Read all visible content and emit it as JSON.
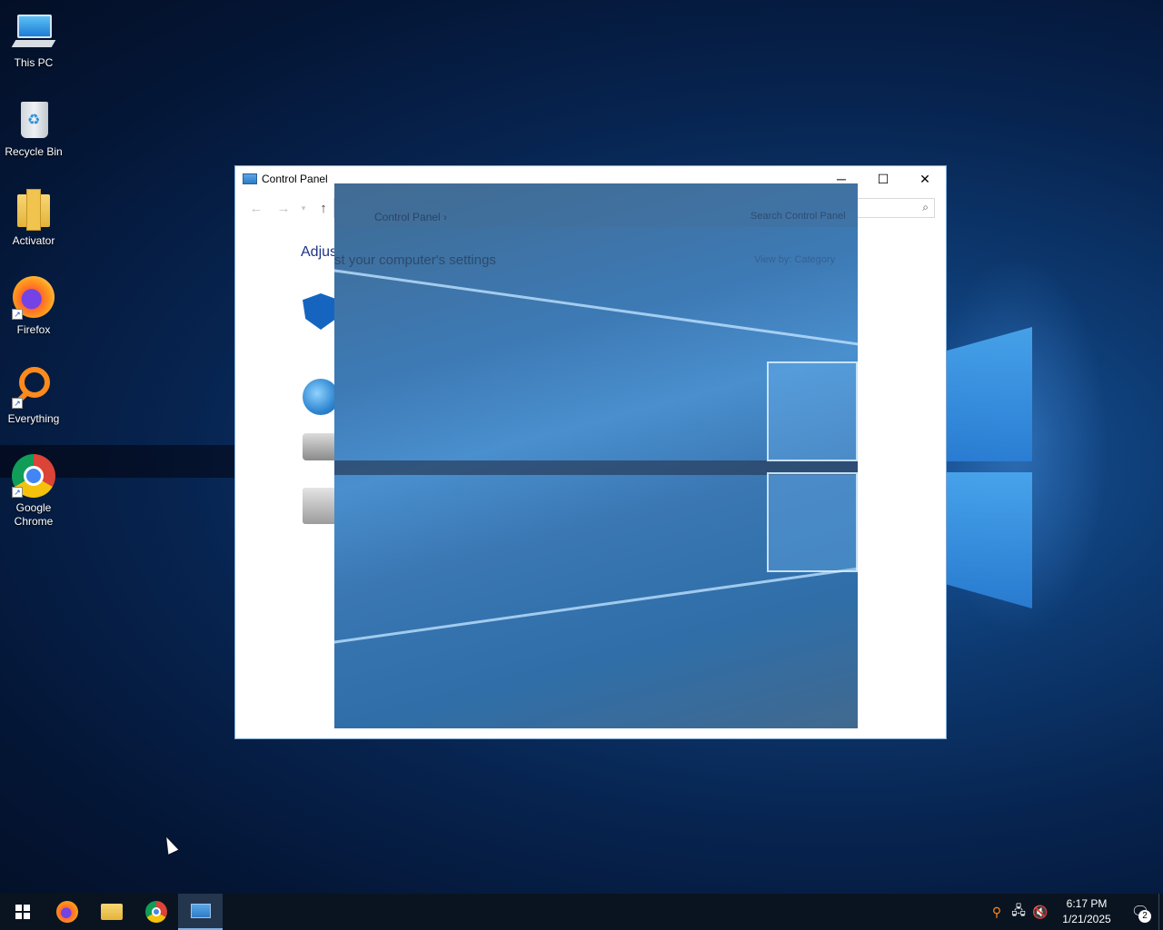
{
  "desktop": {
    "icons": [
      {
        "label": "This PC",
        "icon": "this-pc-icon"
      },
      {
        "label": "Recycle Bin",
        "icon": "recycle-bin-icon"
      },
      {
        "label": "Activator",
        "icon": "folder-icon"
      },
      {
        "label": "Firefox",
        "icon": "firefox-icon"
      },
      {
        "label": "Everything",
        "icon": "everything-search-icon"
      },
      {
        "label": "Google Chrome",
        "icon": "chrome-icon"
      }
    ]
  },
  "window": {
    "title": "Control Panel",
    "minimize": "─",
    "maximize": "☐",
    "close": "✕",
    "back": "←",
    "forward": "→",
    "recent": "▾",
    "up": "↑",
    "heading_visible": "Adjus",
    "search_glyph": "⌕"
  },
  "ghost": {
    "breadcrumb": "Control Panel  ›",
    "search_placeholder": "Search Control Panel",
    "heading": "st your computer's settings",
    "view_by_label": "View by:",
    "view_by_value": "Category"
  },
  "taskbar": {
    "items": [
      "start",
      "firefox",
      "file-explorer",
      "chrome",
      "control-panel"
    ],
    "active": "control-panel"
  },
  "tray": {
    "time": "6:17 PM",
    "date": "1/21/2025",
    "notification_count": "2",
    "network_glyph": "🖧",
    "volume_glyph": "🔇",
    "search_glyph": "⚲",
    "notification_glyph": "🗨"
  }
}
